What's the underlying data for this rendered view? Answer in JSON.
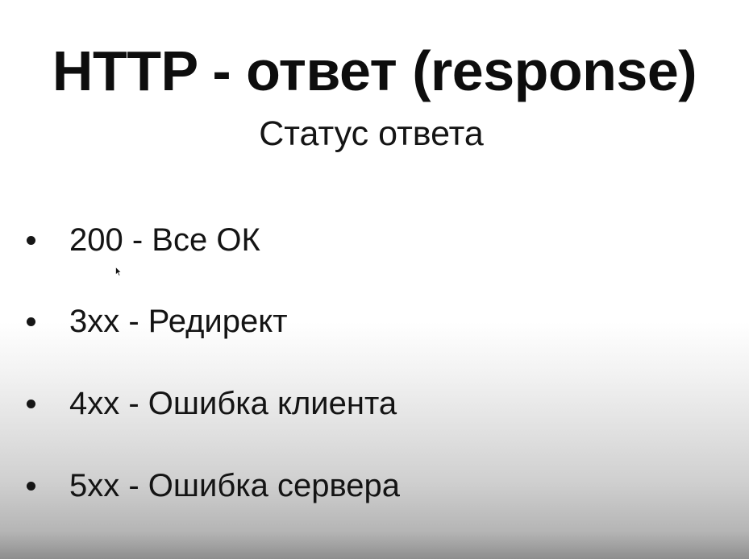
{
  "slide": {
    "title": "HTTP - ответ (response)",
    "subtitle": "Статус ответа",
    "items": [
      {
        "text": "200 - Все ОК"
      },
      {
        "text": "3xx - Редирект"
      },
      {
        "text": "4xx - Ошибка клиента"
      },
      {
        "text": "5xx - Ошибка сервера"
      }
    ]
  },
  "icons": {
    "bullet": "bullet-dot-icon",
    "cursor": "mouse-pointer-icon"
  }
}
